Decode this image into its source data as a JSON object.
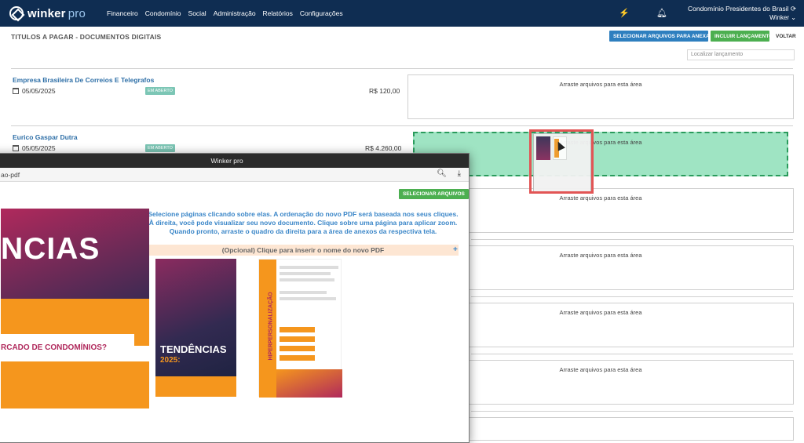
{
  "navbar": {
    "brand": "winker",
    "brand_suffix": "pro",
    "menu": [
      "Financeiro",
      "Condomínio",
      "Social",
      "Administração",
      "Relatórios",
      "Configurações"
    ],
    "account_name": "Condomínio Presidentes do Brasil",
    "account_sub": "Winker",
    "icons": [
      "bolt-icon",
      "bell-icon",
      "refresh-icon",
      "chevron-down-icon"
    ]
  },
  "page": {
    "title": "TITULOS A PAGAR - DOCUMENTOS DIGITAIS",
    "btn_select": "SELECIONAR ARQUIVOS PARA ANEXAR",
    "btn_include": "INCLUIR LANÇAMENTO",
    "btn_back": "VOLTAR",
    "search_placeholder": "Localizar lançamento"
  },
  "rows": [
    {
      "name": "Empresa Brasileira De Correios E Telegrafos",
      "date": "05/05/2025",
      "status": "EM ABERTO",
      "amount": "R$ 120,00"
    },
    {
      "name": "Eurico Gaspar Dutra",
      "date": "05/05/2025",
      "status": "EM ABERTO",
      "amount": "R$ 4.260,00"
    }
  ],
  "dropzone_label": "Arraste arquivos para esta área",
  "overlay": {
    "window_title": "Winker pro",
    "address": "ao-pdf",
    "btn_select_files": "SELECIONAR ARQUIVOS",
    "instructions": [
      "Selecione páginas clicando sobre elas. A ordenação do novo PDF será baseada nos seus cliques.",
      "À direita, você pode visualizar seu novo documento. Clique sobre uma página para aplicar zoom.",
      "Quando pronto, arraste o quadro da direita para a área de anexos da respectiva tela."
    ],
    "name_prompt": "(Opcional) Clique para inserir o nome do novo PDF",
    "big_page_word": "NCIAS",
    "big_page_question": "RCADO DE CONDOMÍNIOS?",
    "thumb1_word": "TENDÊNCIAS",
    "thumb1_year": "2025:",
    "thumb2_vertical": "HIPERPERSONALIZAÇÃO"
  },
  "colors": {
    "navbar": "#0f2d52",
    "accent_blue": "#2e7fbf",
    "accent_green": "#4caf50",
    "drop_active": "#9fe4c3",
    "highlight_red": "#e25555"
  }
}
